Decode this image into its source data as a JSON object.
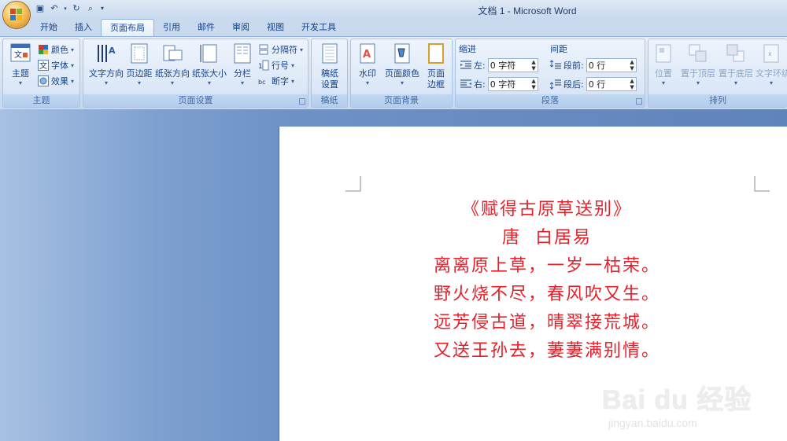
{
  "window": {
    "title": "文档 1 - Microsoft Word"
  },
  "tabs": [
    "开始",
    "插入",
    "页面布局",
    "引用",
    "邮件",
    "审阅",
    "视图",
    "开发工具"
  ],
  "active_tab": "页面布局",
  "ribbon": {
    "theme_group": {
      "label": "主题",
      "theme_button": "主题",
      "colors": "颜色",
      "fonts": "字体",
      "effects": "效果"
    },
    "page_setup_group": {
      "label": "页面设置",
      "text_direction": "文字方向",
      "margins": "页边距",
      "orientation": "纸张方向",
      "size": "纸张大小",
      "columns": "分栏",
      "breaks": "分隔符",
      "line_numbers": "行号",
      "hyphenation": "断字"
    },
    "manuscript_group": {
      "label": "稿纸",
      "button_line1": "稿纸",
      "button_line2": "设置"
    },
    "page_background_group": {
      "label": "页面背景",
      "watermark": "水印",
      "page_color": "页面颜色",
      "borders_line1": "页面",
      "borders_line2": "边框"
    },
    "paragraph_group": {
      "label": "段落",
      "indent_title": "缩进",
      "indent_left_label": "左:",
      "indent_left_value": "0 字符",
      "indent_right_label": "右:",
      "indent_right_value": "0 字符",
      "spacing_title": "间距",
      "spacing_before_label": "段前:",
      "spacing_before_value": "0 行",
      "spacing_after_label": "段后:",
      "spacing_after_value": "0 行"
    },
    "arrange_group": {
      "label": "排列",
      "position": "位置",
      "bring_front": "置于顶层",
      "send_back": "置于底层",
      "text_wrap": "文字环绕"
    }
  },
  "document": {
    "lines": [
      "《赋得古原草送别》",
      "唐  白居易",
      "离离原上草，一岁一枯荣。",
      "野火烧不尽，春风吹又生。",
      "远芳侵古道，晴翠接荒城。",
      "又送王孙去，萋萋满别情。"
    ],
    "text_color": "#e8202a"
  },
  "watermark": {
    "brand": "Bai du 经验",
    "url": "jingyan.baidu.com"
  }
}
